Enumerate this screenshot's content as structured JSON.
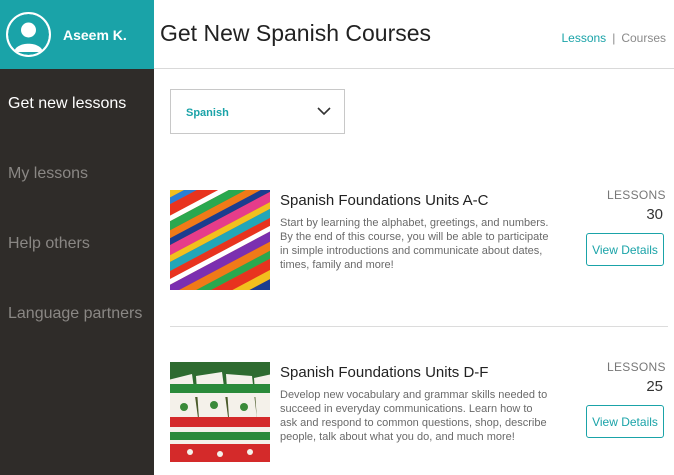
{
  "user": {
    "name": "Aseem K.",
    "avatar_icon": "user-silhouette-icon"
  },
  "sidebar": {
    "items": [
      {
        "label": "Get new lessons",
        "active": true
      },
      {
        "label": "My lessons",
        "active": false
      },
      {
        "label": "Help others",
        "active": false
      },
      {
        "label": "Language partners",
        "active": false
      }
    ]
  },
  "header": {
    "title": "Get New Spanish Courses",
    "breadcrumb": {
      "lessons": "Lessons",
      "separator": "|",
      "courses": "Courses"
    }
  },
  "filter": {
    "selected": "Spanish",
    "icon": "chevron-down-icon"
  },
  "courses": [
    {
      "title": "Spanish Foundations Units A-C",
      "description": "Start by learning the alphabet, greetings, and numbers. By the end of this course, you will be able to participate in simple introductions and communicate about dates, times, family and more!",
      "lessons_label": "LESSONS",
      "lessons_count": "30",
      "button": "View Details"
    },
    {
      "title": "Spanish Foundations Units D-F",
      "description": "Develop new vocabulary and grammar skills needed to succeed in everyday communications. Learn how to ask and respond to common questions, shop, describe people, talk about what you do, and much more!",
      "lessons_label": "LESSONS",
      "lessons_count": "25",
      "button": "View Details"
    }
  ],
  "colors": {
    "accent": "#1aa3a8",
    "sidebar": "#2f2c29",
    "text": "#222222"
  }
}
